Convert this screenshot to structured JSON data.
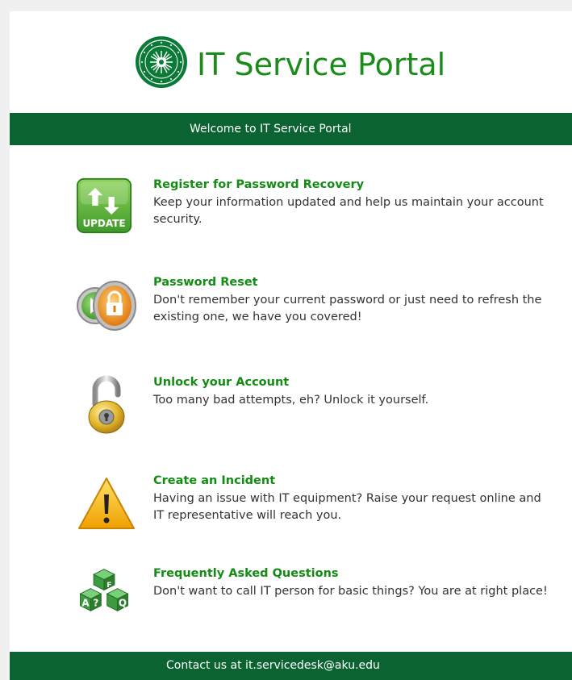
{
  "header": {
    "title": "IT Service Portal"
  },
  "welcome": {
    "text": "Welcome to IT Service Portal"
  },
  "services": [
    {
      "icon": "update-icon",
      "title": "Register for Password Recovery",
      "description": "Keep your information updated and help us maintain your account security."
    },
    {
      "icon": "password-reset-icon",
      "title": "Password Reset",
      "description": "Don't remember your current password or just need to refresh the existing one, we have you covered!"
    },
    {
      "icon": "padlock-icon",
      "title": "Unlock your Account",
      "description": "Too many bad attempts, eh? Unlock it yourself."
    },
    {
      "icon": "warning-icon",
      "title": "Create an Incident",
      "description": "Having an issue with IT equipment? Raise your request online and IT representative will reach you."
    },
    {
      "icon": "faq-cubes-icon",
      "title": "Frequently Asked Questions",
      "description": "Don't want to call IT person for basic things? You are at right place!"
    }
  ],
  "footer": {
    "text": "Contact us at it.servicedesk@aku.edu"
  },
  "colors": {
    "brand_green": "#0a6330",
    "title_green": "#1a8c1a",
    "link_green": "#138c13"
  }
}
